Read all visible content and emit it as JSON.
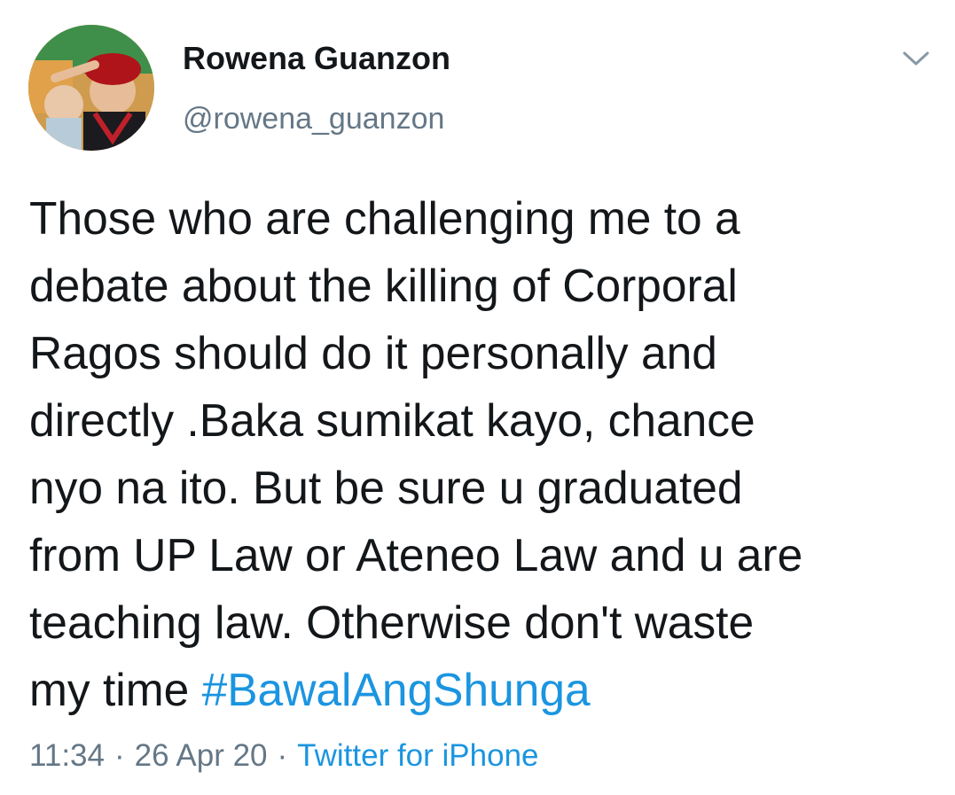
{
  "author": {
    "display_name": "Rowena Guanzon",
    "handle": "@rowena_guanzon",
    "avatar_icon": "profile-photo"
  },
  "menu": {
    "icon": "chevron-down-icon"
  },
  "tweet": {
    "lines": [
      "Those who are challenging me to a",
      "debate about the killing of Corporal",
      "Ragos  should do it personally and",
      "directly .Baka sumikat kayo, chance",
      "nyo na ito. But be sure u graduated",
      "from UP Law or Ateneo Law and u are",
      "teaching law. Otherwise don't waste",
      "my time "
    ],
    "hashtag": "#BawalAngShunga"
  },
  "meta": {
    "time": "11:34",
    "separator": "·",
    "date": "26 Apr 20",
    "source": "Twitter for iPhone"
  },
  "colors": {
    "text": "#14171a",
    "secondary": "#657786",
    "link": "#1b95e0"
  }
}
